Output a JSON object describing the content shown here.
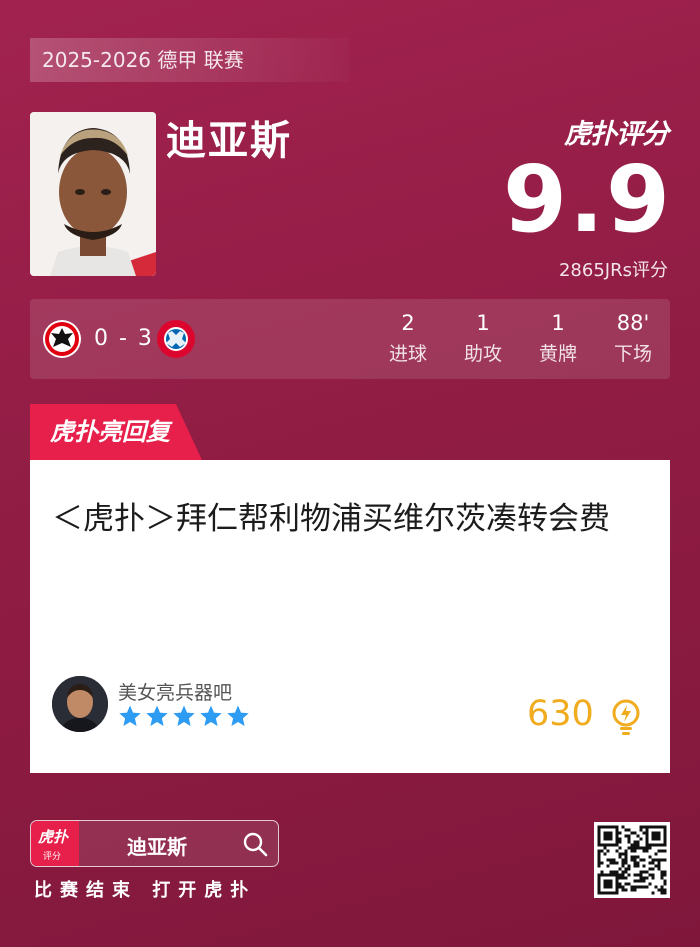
{
  "season_label": "2025-2026 德甲 联赛",
  "player": {
    "name": "迪亚斯"
  },
  "brand": "虎扑评分",
  "rating": {
    "score": "9.9",
    "votes_label": "2865JRs评分"
  },
  "match": {
    "score": "0 - 3",
    "home_crest_icon": "eintracht-frankfurt-crest-icon",
    "away_crest_icon": "bayern-munich-crest-icon",
    "stats": [
      {
        "value": "2",
        "label": "进球"
      },
      {
        "value": "1",
        "label": "助攻"
      },
      {
        "value": "1",
        "label": "黄牌"
      },
      {
        "value": "88'",
        "label": "下场"
      }
    ]
  },
  "section_tag": "虎扑亮回复",
  "reply": {
    "text": "＜虎扑＞拜仁帮利物浦买维尔茨凑转会费",
    "author": "美女亮兵器吧",
    "stars": 5,
    "likes": "630"
  },
  "footer": {
    "app_icon_text": "虎扑",
    "app_icon_sub": "评分",
    "search_text": "迪亚斯",
    "cta": "比赛结束 打开虎扑"
  },
  "colors": {
    "background": "#921d45",
    "accent": "#e6204a",
    "likes": "#f0ab1f",
    "stars": "#2e9cf3"
  }
}
